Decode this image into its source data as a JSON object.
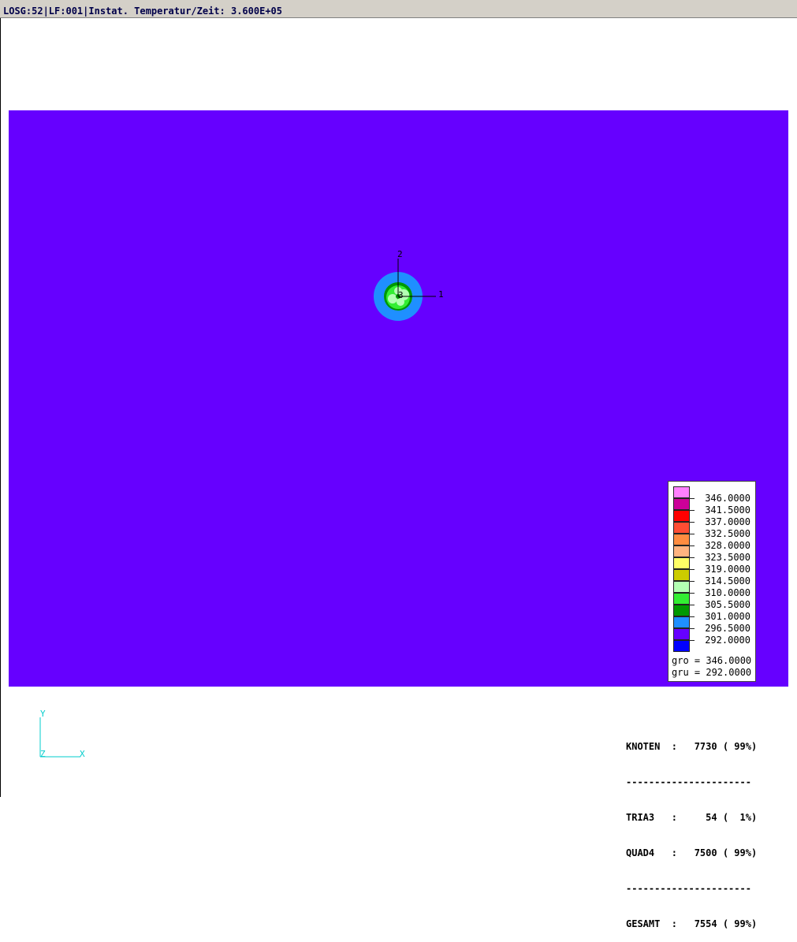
{
  "title_bar": {
    "text": "LOSG:52|LF:001|Instat. Temperatur/Zeit: 3.600E+05"
  },
  "model_axes": {
    "label_1": "1",
    "label_2": "2",
    "label_3": "3"
  },
  "colors": {
    "background_field": "#6600ff",
    "ring_outer": "#1f8fff",
    "ring_mid": "#009900",
    "core": "#b3ffb3",
    "triad": "#00cccc"
  },
  "legend": {
    "swatch_colors": [
      "#ff80ff",
      "#cc0099",
      "#ff0000",
      "#ff4d33",
      "#ff8c40",
      "#ffb380",
      "#ffff66",
      "#cccc00",
      "#b3ffb3",
      "#33ee33",
      "#009900",
      "#1f8fff",
      "#6600ff",
      "#0000ff"
    ],
    "values": [
      "346.0000",
      "341.5000",
      "337.0000",
      "332.5000",
      "328.0000",
      "323.5000",
      "319.0000",
      "314.5000",
      "310.0000",
      "305.5000",
      "301.0000",
      "296.5000",
      "292.0000"
    ],
    "gro": "gro = 346.0000",
    "gru": "gru = 292.0000"
  },
  "triad": {
    "y": "Y",
    "z": "Z",
    "x": "X"
  },
  "stats": {
    "knoten": "KNOTEN  :   7730 ( 99%)",
    "sep1": "----------------------",
    "tria3": "TRIA3   :     54 (  1%)",
    "quad4": "QUAD4   :   7500 ( 99%)",
    "sep2": "----------------------",
    "gesamt": "GESAMT  :   7554 ( 99%)"
  }
}
